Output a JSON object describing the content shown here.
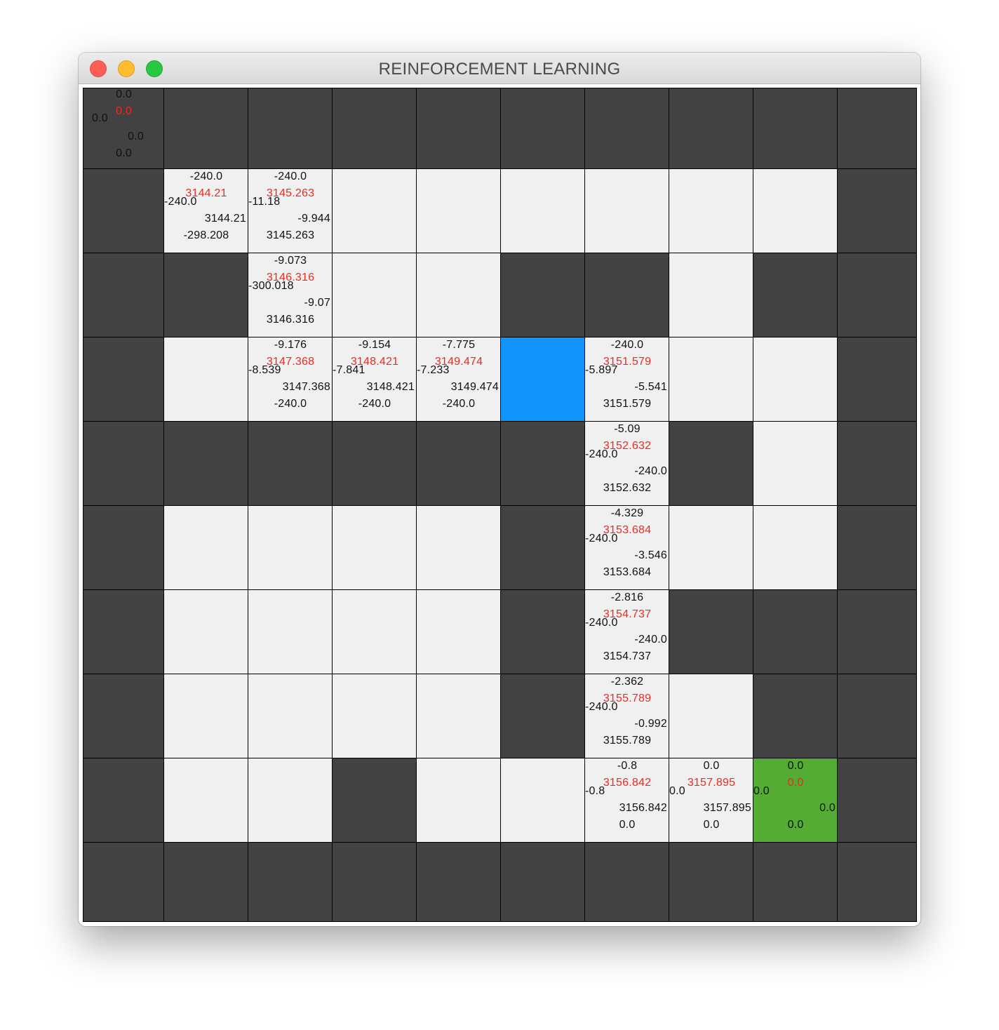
{
  "window": {
    "title": "REINFORCEMENT LEARNING",
    "controls": {
      "close": "close-button",
      "minimize": "minimize-button",
      "zoom": "zoom-button"
    }
  },
  "colors": {
    "wall": "#424242",
    "free": "#f0f0f0",
    "agent": "#1194fa",
    "goal": "#55ac35",
    "value_text": "#ee2a1e",
    "q_text": "#111111"
  },
  "grid": {
    "rows": 10,
    "cols": 10,
    "cell_types": [
      [
        "W",
        "W",
        "W",
        "W",
        "W",
        "W",
        "W",
        "W",
        "W",
        "W"
      ],
      [
        "W",
        "F",
        "F",
        "F",
        "F",
        "F",
        "F",
        "F",
        "F",
        "W"
      ],
      [
        "W",
        "W",
        "F",
        "F",
        "F",
        "W",
        "W",
        "F",
        "W",
        "W"
      ],
      [
        "W",
        "F",
        "F",
        "F",
        "F",
        "A",
        "F",
        "F",
        "F",
        "W"
      ],
      [
        "W",
        "W",
        "W",
        "W",
        "W",
        "W",
        "F",
        "W",
        "F",
        "W"
      ],
      [
        "W",
        "F",
        "F",
        "F",
        "F",
        "W",
        "F",
        "F",
        "F",
        "W"
      ],
      [
        "W",
        "F",
        "F",
        "F",
        "F",
        "W",
        "F",
        "W",
        "W",
        "W"
      ],
      [
        "W",
        "F",
        "F",
        "F",
        "F",
        "W",
        "F",
        "F",
        "W",
        "W"
      ],
      [
        "W",
        "F",
        "F",
        "W",
        "F",
        "F",
        "F",
        "F",
        "G",
        "W"
      ],
      [
        "W",
        "W",
        "W",
        "W",
        "W",
        "W",
        "W",
        "W",
        "W",
        "W"
      ]
    ],
    "legend": {
      "W": "wall",
      "F": "free",
      "A": "agent",
      "G": "goal"
    },
    "values": [
      {
        "row": 0,
        "col": 0,
        "up": "0.0",
        "value": "0.0",
        "left": "0.0",
        "right": "0.0",
        "down": "0.0"
      },
      {
        "row": 1,
        "col": 1,
        "up": "-240.0",
        "value": "3144.21",
        "left": "-240.0",
        "right": "3144.21",
        "down": "-298.208"
      },
      {
        "row": 1,
        "col": 2,
        "up": "-240.0",
        "value": "3145.263",
        "left": "-11.18",
        "right": "-9.944",
        "down": "3145.263"
      },
      {
        "row": 2,
        "col": 2,
        "up": "-9.073",
        "value": "3146.316",
        "left": "-300.018",
        "right": "-9.07",
        "down": "3146.316"
      },
      {
        "row": 3,
        "col": 2,
        "up": "-9.176",
        "value": "3147.368",
        "left": "-8.539",
        "right": "3147.368",
        "down": "-240.0"
      },
      {
        "row": 3,
        "col": 3,
        "up": "-9.154",
        "value": "3148.421",
        "left": "-7.841",
        "right": "3148.421",
        "down": "-240.0"
      },
      {
        "row": 3,
        "col": 4,
        "up": "-7.775",
        "value": "3149.474",
        "left": "-7.233",
        "right": "3149.474",
        "down": "-240.0"
      },
      {
        "row": 3,
        "col": 6,
        "up": "-240.0",
        "value": "3151.579",
        "left": "-5.897",
        "right": "-5.541",
        "down": "3151.579"
      },
      {
        "row": 4,
        "col": 6,
        "up": "-5.09",
        "value": "3152.632",
        "left": "-240.0",
        "right": "-240.0",
        "down": "3152.632"
      },
      {
        "row": 5,
        "col": 6,
        "up": "-4.329",
        "value": "3153.684",
        "left": "-240.0",
        "right": "-3.546",
        "down": "3153.684"
      },
      {
        "row": 6,
        "col": 6,
        "up": "-2.816",
        "value": "3154.737",
        "left": "-240.0",
        "right": "-240.0",
        "down": "3154.737"
      },
      {
        "row": 7,
        "col": 6,
        "up": "-2.362",
        "value": "3155.789",
        "left": "-240.0",
        "right": "-0.992",
        "down": "3155.789"
      },
      {
        "row": 8,
        "col": 6,
        "up": "-0.8",
        "value": "3156.842",
        "left": "-0.8",
        "right": "3156.842",
        "down": "0.0"
      },
      {
        "row": 8,
        "col": 7,
        "up": "0.0",
        "value": "3157.895",
        "left": "0.0",
        "right": "3157.895",
        "down": "0.0"
      },
      {
        "row": 8,
        "col": 8,
        "up": "0.0",
        "value": "0.0",
        "left": "0.0",
        "right": "0.0",
        "down": "0.0"
      }
    ]
  }
}
